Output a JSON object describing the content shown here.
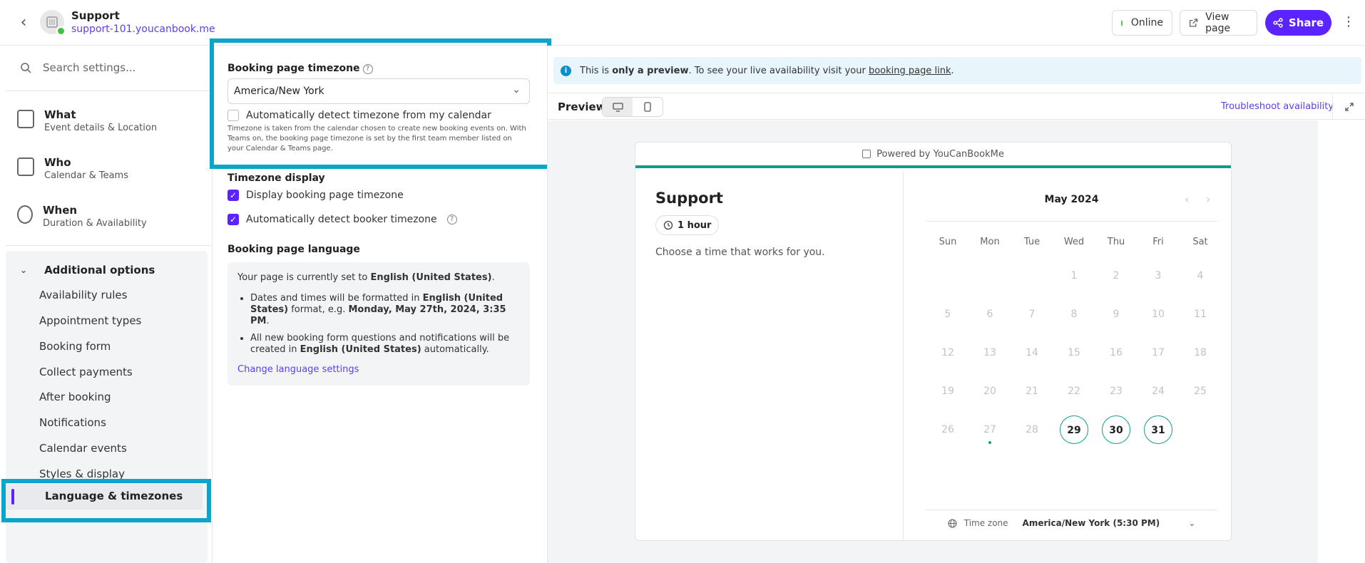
{
  "header": {
    "title": "Support",
    "url": "support-101.youcanbook.me",
    "online_label": "Online",
    "view_page_label": "View page",
    "share_label": "Share"
  },
  "sidebar": {
    "search_placeholder": "Search settings...",
    "main_items": [
      {
        "title": "What",
        "subtitle": "Event details & Location"
      },
      {
        "title": "Who",
        "subtitle": "Calendar & Teams"
      },
      {
        "title": "When",
        "subtitle": "Duration & Availability"
      }
    ],
    "additional_label": "Additional options",
    "sub_items": [
      "Availability rules",
      "Appointment types",
      "Booking form",
      "Collect payments",
      "After booking",
      "Notifications",
      "Calendar events",
      "Styles & display"
    ],
    "active_item": "Language & timezones"
  },
  "settings": {
    "tz_label": "Booking page timezone",
    "tz_value": "America/New York",
    "auto_detect_calendar_label": "Automatically detect timezone from my calendar",
    "tz_note": "Timezone is taken from the calendar chosen to create new booking events on. With Teams on, the booking page timezone is set by the first team member listed on your Calendar & Teams page.",
    "tz_display_label": "Timezone display",
    "display_tz_label": "Display booking page timezone",
    "auto_detect_booker_label": "Automatically detect booker timezone",
    "lang_label": "Booking page language",
    "lang_intro_prefix": "Your page is currently set to ",
    "lang_intro_value": "English (United States)",
    "lang_bullet1_a": "Dates and times will be formatted in ",
    "lang_bullet1_b": "English (United States)",
    "lang_bullet1_c": " format, e.g. ",
    "lang_bullet1_d": "Monday, May 27th, 2024, 3:35 PM",
    "lang_bullet2_a": "All new booking form questions and notifications will be created in ",
    "lang_bullet2_b": "English (United States)",
    "lang_bullet2_c": " automatically.",
    "change_lang_link": "Change language settings"
  },
  "preview": {
    "banner_a": "This is ",
    "banner_b": "only a preview",
    "banner_c": ". To see your live availability visit your ",
    "banner_link": "booking page link",
    "banner_d": ".",
    "label": "Preview",
    "troubleshoot": "Troubleshoot availability",
    "powered": "Powered by YouCanBookMe",
    "widget_title": "Support",
    "duration": "1 hour",
    "choose_text": "Choose a time that works for you.",
    "month": "May 2024",
    "weekdays": [
      "Sun",
      "Mon",
      "Tue",
      "Wed",
      "Thu",
      "Fri",
      "Sat"
    ],
    "weeks": [
      [
        "",
        "",
        "",
        "1",
        "2",
        "3",
        "4"
      ],
      [
        "5",
        "6",
        "7",
        "8",
        "9",
        "10",
        "11"
      ],
      [
        "12",
        "13",
        "14",
        "15",
        "16",
        "17",
        "18"
      ],
      [
        "19",
        "20",
        "21",
        "22",
        "23",
        "24",
        "25"
      ],
      [
        "26",
        "27",
        "28",
        "29",
        "30",
        "31",
        ""
      ]
    ],
    "available_days": [
      "29",
      "30",
      "31"
    ],
    "today": "27",
    "tz_label": "Time zone",
    "tz_value": "America/New York (5:30 PM)"
  },
  "colors": {
    "accent": "#5b23ff",
    "teal": "#179a8e",
    "highlight": "#0aa5c9"
  }
}
